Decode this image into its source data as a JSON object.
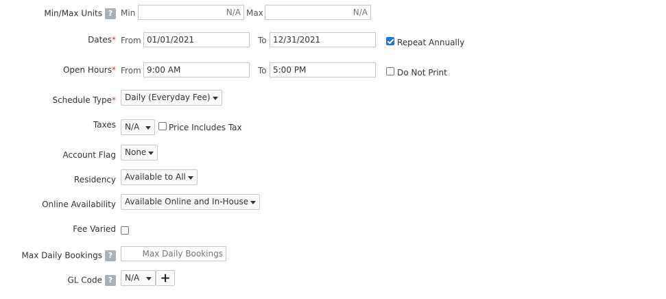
{
  "min_max_units": {
    "label": "Min/Max Units",
    "help": "?",
    "min_label": "Min",
    "min_placeholder": "N/A",
    "max_label": "Max",
    "max_placeholder": "N/A"
  },
  "dates": {
    "label": "Dates",
    "required": "*",
    "from_label": "From",
    "from_value": "01/01/2021",
    "to_label": "To",
    "to_value": "12/31/2021",
    "repeat_label": "Repeat Annually",
    "repeat_checked": true
  },
  "open_hours": {
    "label": "Open Hours",
    "required": "*",
    "from_label": "From",
    "from_value": "9:00 AM",
    "to_label": "To",
    "to_value": "5:00 PM",
    "do_not_print_label": "Do Not Print",
    "do_not_print_checked": false
  },
  "schedule_type": {
    "label": "Schedule Type",
    "required": "*",
    "value": "Daily (Everyday Fee)"
  },
  "taxes": {
    "label": "Taxes",
    "value": "N/A",
    "price_includes_tax_label": "Price Includes Tax",
    "checked": false
  },
  "account_flag": {
    "label": "Account Flag",
    "value": "None"
  },
  "residency": {
    "label": "Residency",
    "value": "Available to All"
  },
  "online_availability": {
    "label": "Online Availability",
    "value": "Available Online and In-House"
  },
  "fee_varied": {
    "label": "Fee Varied",
    "checked": false
  },
  "max_daily_bookings": {
    "label": "Max Daily Bookings",
    "help": "?",
    "placeholder": "Max Daily Bookings"
  },
  "gl_code": {
    "label": "GL Code",
    "help": "?",
    "value": "N/A",
    "add_symbol": "+"
  },
  "colors": {
    "accent": "#1a73e8",
    "required": "#c0392b",
    "help_bg": "#a9b1b8"
  }
}
